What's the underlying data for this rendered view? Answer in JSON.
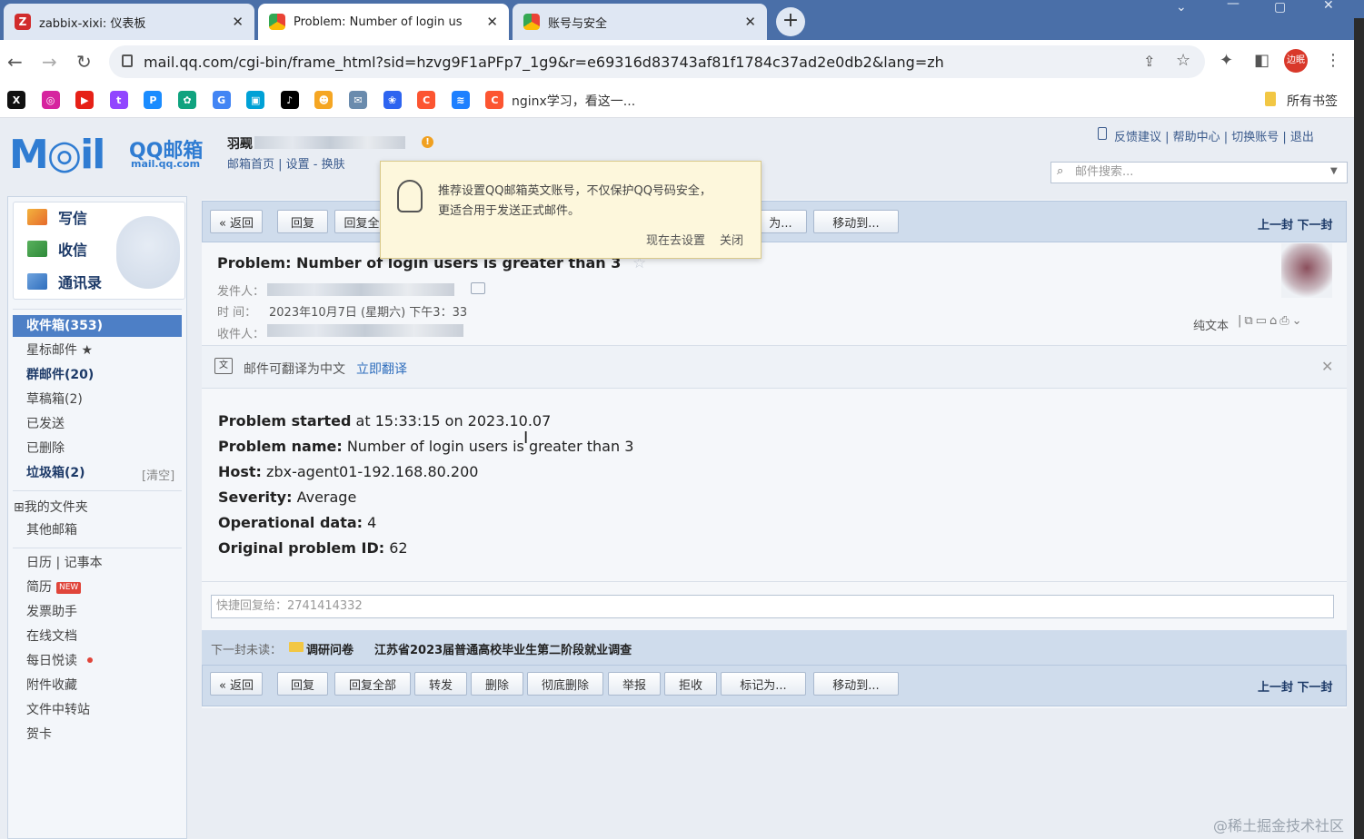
{
  "browser": {
    "tabs": [
      {
        "label": "zabbix-xixi: 仪表板",
        "icon": "Z",
        "color": "#d12c2c",
        "active": false
      },
      {
        "label": "Problem: Number of login us",
        "icon": "G",
        "color": "#3b82f6",
        "active": true
      },
      {
        "label": "账号与安全",
        "icon": "G",
        "color": "#3b82f6",
        "active": false
      }
    ],
    "url": "mail.qq.com/cgi-bin/frame_html?sid=hzvg9F1aPFp7_1g9&r=e69316d83743af81f1784c37ad2e0db2&lang=zh",
    "profile": "边眠",
    "bookmarks": [
      {
        "icon": "X",
        "color": "#111"
      },
      {
        "icon": "◎",
        "color": "#d6249f"
      },
      {
        "icon": "▶",
        "color": "#e62117"
      },
      {
        "icon": "t",
        "color": "#9146ff"
      },
      {
        "icon": "P",
        "color": "#1a8cff"
      },
      {
        "icon": "✿",
        "color": "#10a37f"
      },
      {
        "icon": "G",
        "color": "#4285f4"
      },
      {
        "icon": "▣",
        "color": "#00a1d6"
      },
      {
        "icon": "♪",
        "color": "#000"
      },
      {
        "icon": "☻",
        "color": "#f5a623"
      },
      {
        "icon": "✉",
        "color": "#6a8bad"
      },
      {
        "icon": "❀",
        "color": "#2d64f0"
      },
      {
        "icon": "C",
        "color": "#fc5531"
      },
      {
        "icon": "≋",
        "color": "#1e80ff"
      },
      {
        "icon": "C",
        "color": "#fc5531"
      }
    ],
    "bookmark_text": "nginx学习，看这一...",
    "all_bookmarks": "所有书签"
  },
  "mail": {
    "logo_text": "M◎il",
    "logo_cn": "QQ邮箱",
    "logo_domain": "mail.qq.com",
    "user_name": "羽觋",
    "user_links": "邮箱首页 | 设置 - 换肤",
    "top_links": "反馈建议 | 帮助中心 | 切换账号 | 退出",
    "search_placeholder": "邮件搜索...",
    "quick": [
      {
        "label": "写信"
      },
      {
        "label": "收信"
      },
      {
        "label": "通讯录"
      }
    ],
    "folders": [
      {
        "label": "收件箱(353)",
        "cls": "sel"
      },
      {
        "label": "星标邮件 ★",
        "cls": ""
      },
      {
        "label": "群邮件(20)",
        "cls": "b"
      },
      {
        "label": "草稿箱(2)",
        "cls": ""
      },
      {
        "label": "已发送",
        "cls": ""
      },
      {
        "label": "已删除",
        "cls": ""
      },
      {
        "label": "垃圾箱(2)",
        "cls": "b"
      }
    ],
    "trash_clear": "[清空]",
    "my_folders": "⊞我的文件夹",
    "other_mail": "其他邮箱",
    "apps": [
      {
        "label": "日历  |  记事本"
      },
      {
        "label": "简历"
      },
      {
        "label": "发票助手"
      },
      {
        "label": "在线文档"
      },
      {
        "label": "每日悦读"
      },
      {
        "label": "附件收藏"
      },
      {
        "label": "文件中转站"
      },
      {
        "label": "贺卡"
      }
    ],
    "new_badge": "NEW",
    "toolbar_top": {
      "back": "« 返回",
      "reply": "回复",
      "reply_all_partial": "回复全",
      "mark_partial": "为...",
      "move": "移动到...",
      "prevnext": "上一封 下一封"
    },
    "toolbar_bottom": {
      "back": "« 返回",
      "reply": "回复",
      "reply_all": "回复全部",
      "forward": "转发",
      "delete": "删除",
      "perm_delete": "彻底删除",
      "report": "举报",
      "reject": "拒收",
      "mark": "标记为...",
      "move": "移动到...",
      "prevnext": "上一封 下一封"
    },
    "subject": "Problem: Number of login users is greater than 3",
    "from_label": "发件人：",
    "time_label": "时  间：",
    "time_value": "2023年10月7日 (星期六) 下午3：33",
    "to_label": "收件人：",
    "view_plain": "纯文本",
    "translate_text": "邮件可翻译为中文",
    "translate_link": "立即翻译",
    "body": [
      {
        "k": "Problem started",
        "v": " at 15:33:15 on 2023.10.07"
      },
      {
        "k": "Problem name:",
        "v": " Number of login users is greater than 3"
      },
      {
        "k": "Host:",
        "v": " zbx-agent01-192.168.80.200"
      },
      {
        "k": "Severity:",
        "v": " Average"
      },
      {
        "k": "Operational data:",
        "v": " 4"
      },
      {
        "k": "Original problem ID:",
        "v": " 62"
      }
    ],
    "quick_reply_placeholder": "快捷回复给：2741414332",
    "next_unread_label": "下一封未读：",
    "next_unread_tag": "调研问卷",
    "next_unread_subject": "江苏省2023届普通高校毕业生第二阶段就业调查",
    "popup": {
      "line1": "推荐设置QQ邮箱英文账号，不仅保护QQ号码安全，",
      "line2": "更适合用于发送正式邮件。",
      "setup": "现在去设置",
      "close": "关闭"
    },
    "watermark": "@稀土掘金技术社区"
  }
}
